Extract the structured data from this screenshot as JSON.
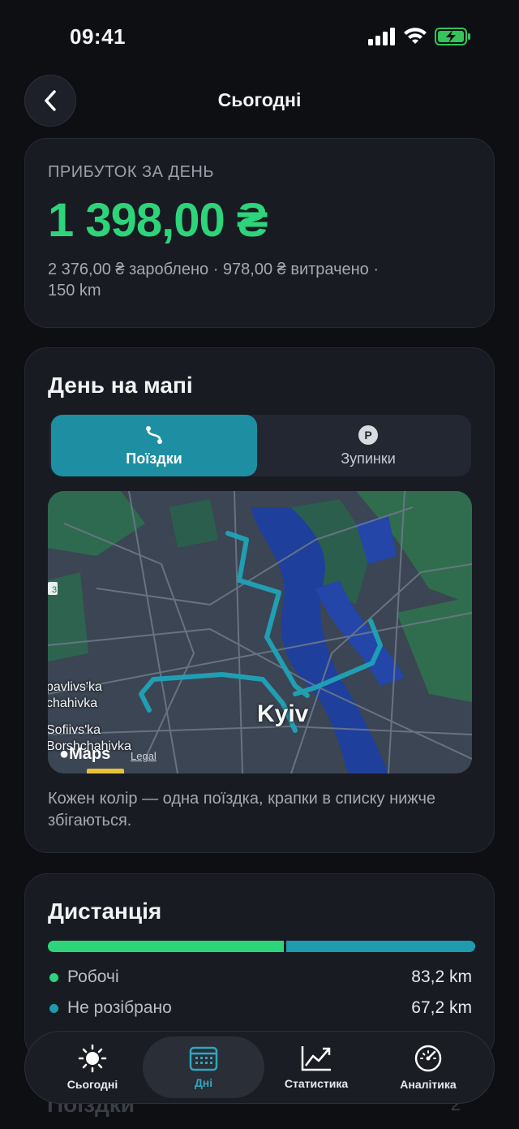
{
  "status": {
    "time": "09:41"
  },
  "nav": {
    "title": "Сьогодні"
  },
  "profit": {
    "label": "ПРИБУТОК ЗА ДЕНЬ",
    "value": "1 398,00 ₴",
    "summary_line1": "2 376,00 ₴ зароблено · 978,00 ₴ витрачено ·",
    "summary_line2": "150 km"
  },
  "map_card": {
    "title": "День на мапі",
    "tabs": [
      {
        "label": "Поїздки",
        "icon": "route-icon",
        "active": true
      },
      {
        "label": "Зупинки",
        "icon": "parking-icon",
        "active": false
      }
    ],
    "map": {
      "city_label": "Kyiv",
      "district_1_line1": "pavlivs'ka",
      "district_1_line2": "chahivka",
      "district_2_line1": "Sofiivs'ka",
      "district_2_line2": "Borshchahivka",
      "shield_label": "3",
      "brand": "Maps",
      "legal": "Legal",
      "route_color": "#1fa3b8"
    },
    "caption": "Кожен колір — одна поїздка, крапки в списку нижче збігаються."
  },
  "distance": {
    "title": "Дистанція",
    "work_fraction": 0.553,
    "rows": [
      {
        "label": "Робочі",
        "value": "83,2 km",
        "color": "#2ed47a"
      },
      {
        "label": "Не розібрано",
        "value": "67,2 km",
        "color": "#1f9bb0"
      }
    ]
  },
  "next_section": {
    "title": "Поїздки",
    "count": "2"
  },
  "tab_bar": {
    "items": [
      {
        "label": "Сьогодні",
        "icon": "sun-icon"
      },
      {
        "label": "Дні",
        "icon": "calendar-icon",
        "active": true
      },
      {
        "label": "Статистика",
        "icon": "chart-trend-icon"
      },
      {
        "label": "Аналітика",
        "icon": "speedometer-icon"
      }
    ]
  }
}
